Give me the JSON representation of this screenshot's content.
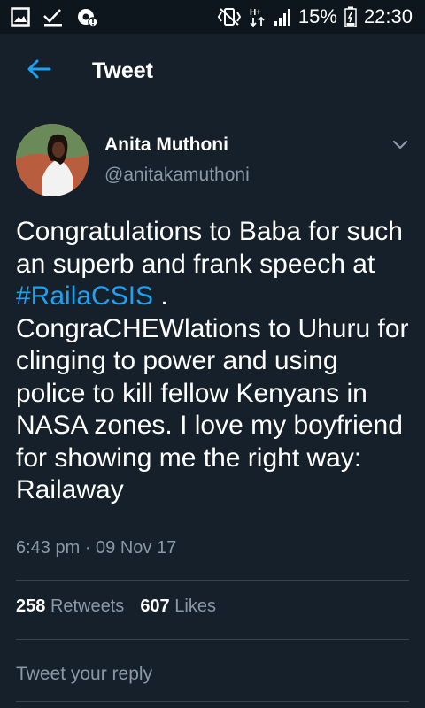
{
  "status_bar": {
    "battery": "15%",
    "time": "22:30",
    "icons_left": [
      "gallery-icon",
      "check-icon",
      "settings-notification-icon"
    ],
    "icons_right": [
      "vibrate-icon",
      "data-hplus-icon",
      "signal-icon",
      "battery-icon"
    ],
    "network_label": "H+"
  },
  "appbar": {
    "title": "Tweet",
    "back_icon": "arrow-left-icon",
    "accent": "#1da1f2"
  },
  "author": {
    "name": "Anita Muthoni",
    "handle": "@anitakamuthoni"
  },
  "tweet": {
    "text_before": "Congratulations to Baba for such an superb and frank speech at ",
    "hashtag": "#RailaCSIS",
    "text_after": " . CongraCHEWlations to Uhuru for clinging to power and using police to kill fellow Kenyans in NASA zones. I love my boyfriend for showing me the right way: Railaway",
    "timestamp": "6:43 pm · 09 Nov 17"
  },
  "stats": {
    "retweets_count": "258",
    "retweets_label": "Retweets",
    "likes_count": "607",
    "likes_label": "Likes"
  },
  "reply": {
    "placeholder": "Tweet your reply"
  },
  "colors": {
    "background": "#15202b",
    "status_bar": "#0d151d",
    "secondary_text": "#8899a6",
    "link": "#1da1f2",
    "divider": "#38444d"
  }
}
